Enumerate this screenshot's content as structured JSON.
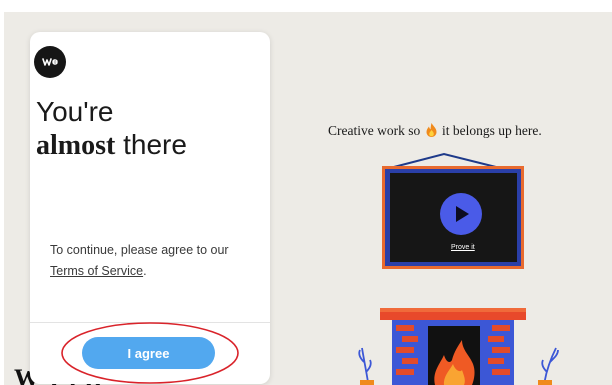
{
  "modal": {
    "title_line1": "You're",
    "title_bold": "almost",
    "title_rest": " there",
    "body_prefix": "To continue, please agree to our ",
    "tos_link": "Terms of Service",
    "body_suffix": ".",
    "agree_button": "I agree"
  },
  "hero": {
    "tagline_before": "Creative work so",
    "tagline_after": "it belongs up here.",
    "prove_link": "Prove it"
  },
  "page": {
    "partial_heading": "W  T     f  D"
  },
  "colors": {
    "accent": "#52a8ef",
    "annotation": "#d9232a",
    "play_button": "#4a5be8"
  },
  "icons": {
    "logo": "we-logo-icon",
    "fire": "fire-icon",
    "play": "play-icon"
  }
}
